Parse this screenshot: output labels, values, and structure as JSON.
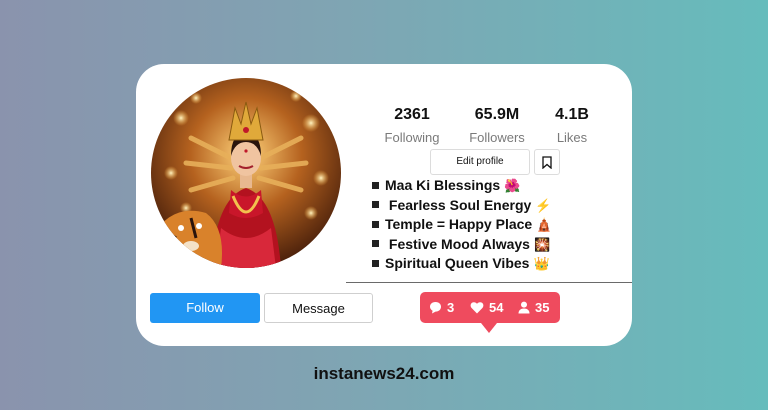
{
  "profile": {
    "stats": [
      {
        "value": "2361",
        "label": "Following"
      },
      {
        "value": "65.9M",
        "label": "Followers"
      },
      {
        "value": "4.1B",
        "label": "Likes"
      }
    ],
    "edit_profile_label": "Edit profile",
    "bio": [
      {
        "text": "Maa Ki Blessings",
        "emoji": "🌺"
      },
      {
        "text": " Fearless Soul Energy",
        "emoji": "⚡"
      },
      {
        "text": "Temple = Happy Place",
        "emoji": "🛕"
      },
      {
        "text": " Festive Mood Always",
        "emoji": "🎇"
      },
      {
        "text": "Spiritual Queen Vibes",
        "emoji": "👑"
      }
    ],
    "follow_label": "Follow",
    "message_label": "Message"
  },
  "notifications": {
    "comments": "3",
    "likes": "54",
    "followers": "35"
  },
  "colors": {
    "follow": "#2196f3",
    "notification": "#ef4b5e"
  },
  "footer": {
    "site": "instanews24.com"
  }
}
